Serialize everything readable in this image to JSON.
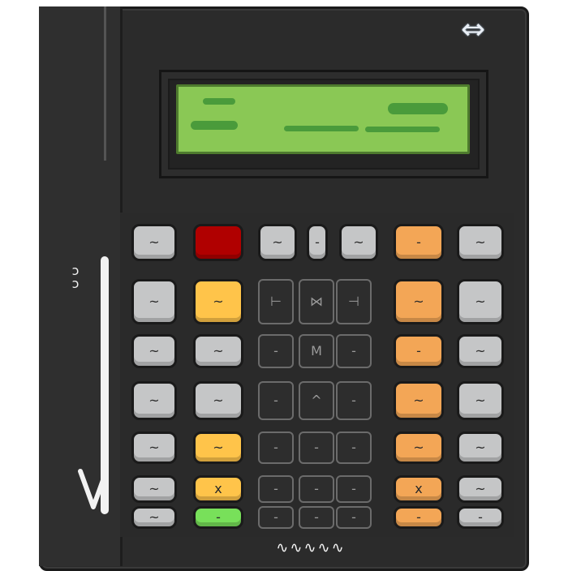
{
  "colors": {
    "body": "#2b2b2b",
    "lcd": "#8ac855",
    "lcd_marks": "#4a9b3b",
    "gray_key": "#c5c6c7",
    "orange_key": "#f3a656",
    "yellow_key": "#ffc44a",
    "red_key": "#b00000",
    "green_key": "#78e05a",
    "dark_key": "#2d2d2d"
  },
  "icons": {
    "top_right": "double-arrow-icon",
    "side": "ear-glyph-icon",
    "slider": "down-arrow-slider-icon",
    "bottom": "squiggle-logo-icon"
  },
  "keypad": {
    "keys": [
      {
        "name": "key-r1c1",
        "color": "gray",
        "glyph": "~"
      },
      {
        "name": "key-r1c2",
        "color": "red",
        "glyph": ""
      },
      {
        "name": "key-r1c3",
        "color": "gray",
        "glyph": "~"
      },
      {
        "name": "key-r1c4",
        "color": "gray",
        "glyph": "-"
      },
      {
        "name": "key-r1c5",
        "color": "gray",
        "glyph": "~"
      },
      {
        "name": "key-r1c6",
        "color": "orange",
        "glyph": "-"
      },
      {
        "name": "key-r1c7",
        "color": "gray",
        "glyph": "~"
      },
      {
        "name": "key-r2c1",
        "color": "gray",
        "glyph": "~"
      },
      {
        "name": "key-r2c2",
        "color": "yellow",
        "glyph": "~"
      },
      {
        "name": "key-r2c3",
        "color": "dark",
        "glyph": "⊢"
      },
      {
        "name": "key-r2c4",
        "color": "dark",
        "glyph": "⋈"
      },
      {
        "name": "key-r2c5",
        "color": "dark",
        "glyph": "⊣"
      },
      {
        "name": "key-r2c6",
        "color": "orange",
        "glyph": "~"
      },
      {
        "name": "key-r2c7",
        "color": "gray",
        "glyph": "~"
      },
      {
        "name": "key-r3c1",
        "color": "gray",
        "glyph": "~"
      },
      {
        "name": "key-r3c2",
        "color": "gray",
        "glyph": "~"
      },
      {
        "name": "key-r3c3",
        "color": "dark",
        "glyph": "-"
      },
      {
        "name": "key-r3c4",
        "color": "dark",
        "glyph": "M"
      },
      {
        "name": "key-r3c5",
        "color": "dark",
        "glyph": "-"
      },
      {
        "name": "key-r3c6",
        "color": "orange",
        "glyph": "-"
      },
      {
        "name": "key-r3c7",
        "color": "gray",
        "glyph": "~"
      },
      {
        "name": "key-r4c1",
        "color": "gray",
        "glyph": "~"
      },
      {
        "name": "key-r4c2",
        "color": "gray",
        "glyph": "~"
      },
      {
        "name": "key-r4c3",
        "color": "dark",
        "glyph": "-"
      },
      {
        "name": "key-r4c4",
        "color": "dark",
        "glyph": "^"
      },
      {
        "name": "key-r4c5",
        "color": "dark",
        "glyph": "-"
      },
      {
        "name": "key-r4c6",
        "color": "orange",
        "glyph": "~"
      },
      {
        "name": "key-r4c7",
        "color": "gray",
        "glyph": "~"
      },
      {
        "name": "key-r5c1",
        "color": "gray",
        "glyph": "~"
      },
      {
        "name": "key-r5c2",
        "color": "yellow",
        "glyph": "~"
      },
      {
        "name": "key-r5c3",
        "color": "dark",
        "glyph": "-"
      },
      {
        "name": "key-r5c4",
        "color": "dark",
        "glyph": "-"
      },
      {
        "name": "key-r5c5",
        "color": "dark",
        "glyph": "-"
      },
      {
        "name": "key-r5c6",
        "color": "orange",
        "glyph": "~"
      },
      {
        "name": "key-r5c7",
        "color": "gray",
        "glyph": "~"
      },
      {
        "name": "key-r6c1",
        "color": "gray",
        "glyph": "~"
      },
      {
        "name": "key-r6c2",
        "color": "yellow",
        "glyph": "x"
      },
      {
        "name": "key-r6c3",
        "color": "dark",
        "glyph": "-"
      },
      {
        "name": "key-r6c4",
        "color": "dark",
        "glyph": "-"
      },
      {
        "name": "key-r6c5",
        "color": "dark",
        "glyph": "-"
      },
      {
        "name": "key-r6c6",
        "color": "orange",
        "glyph": "x"
      },
      {
        "name": "key-r6c7",
        "color": "gray",
        "glyph": "~"
      },
      {
        "name": "key-r7c1",
        "color": "gray",
        "glyph": "~"
      },
      {
        "name": "key-r7c2",
        "color": "green",
        "glyph": "-"
      },
      {
        "name": "key-r7c3",
        "color": "dark",
        "glyph": "-"
      },
      {
        "name": "key-r7c4",
        "color": "dark",
        "glyph": "-"
      },
      {
        "name": "key-r7c5",
        "color": "dark",
        "glyph": "-"
      },
      {
        "name": "key-r7c6",
        "color": "orange",
        "glyph": "-"
      },
      {
        "name": "key-r7c7",
        "color": "gray",
        "glyph": "-"
      }
    ]
  }
}
